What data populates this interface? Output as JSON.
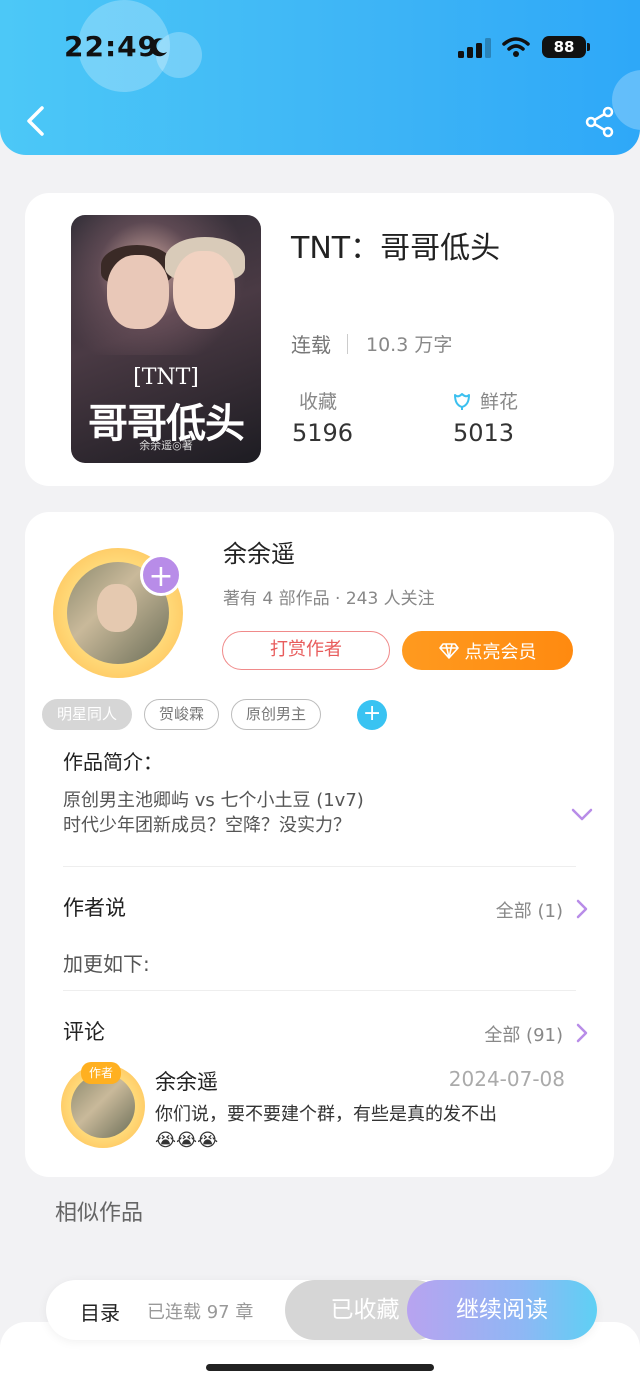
{
  "status_bar": {
    "time": "22:49",
    "battery": "88"
  },
  "book": {
    "cover": {
      "tag": "[TNT]",
      "title": "哥哥低头",
      "author": "余余遥◎著"
    },
    "title": "TNT：哥哥低头",
    "status": "连载",
    "word_count": "10.3 万字",
    "favorites_label": "收藏",
    "favorites_value": "5196",
    "flowers_label": "鲜花",
    "flowers_value": "5013"
  },
  "author": {
    "name": "余余遥",
    "meta": "著有 4 部作品 · 243 人关注",
    "follow_symbol": "+",
    "tip_label": "打赏作者",
    "vip_label": "点亮会员"
  },
  "tags": {
    "items": [
      "明星同人",
      "贺峻霖",
      "原创男主"
    ],
    "add_symbol": "+"
  },
  "intro": {
    "title": "作品简介：",
    "line1": "原创男主池卿屿 vs 七个小土豆 (1v7)",
    "line2": "时代少年团新成员？空降？没实力？"
  },
  "author_says": {
    "title": "作者说",
    "more": "全部 (1)",
    "text": "加更如下:"
  },
  "comments": {
    "title": "评论",
    "more": "全部 (91)",
    "item": {
      "badge": "作者",
      "name": "余余遥",
      "date": "2024-07-08",
      "text_line1": "你们说，要不要建个群，有些是真的发不出",
      "text_line2": "😭😭😭"
    }
  },
  "similar": {
    "title": "相似作品"
  },
  "bottom_bar": {
    "toc": "目录",
    "chapters": "已连载 97 章",
    "collected": "已收藏",
    "continue": "继续阅读"
  },
  "colors": {
    "header": "#3db4f6",
    "accent_purple": "#b88ce8",
    "vip_orange": "#ff9a1f",
    "tip_red": "#e85c5c"
  }
}
